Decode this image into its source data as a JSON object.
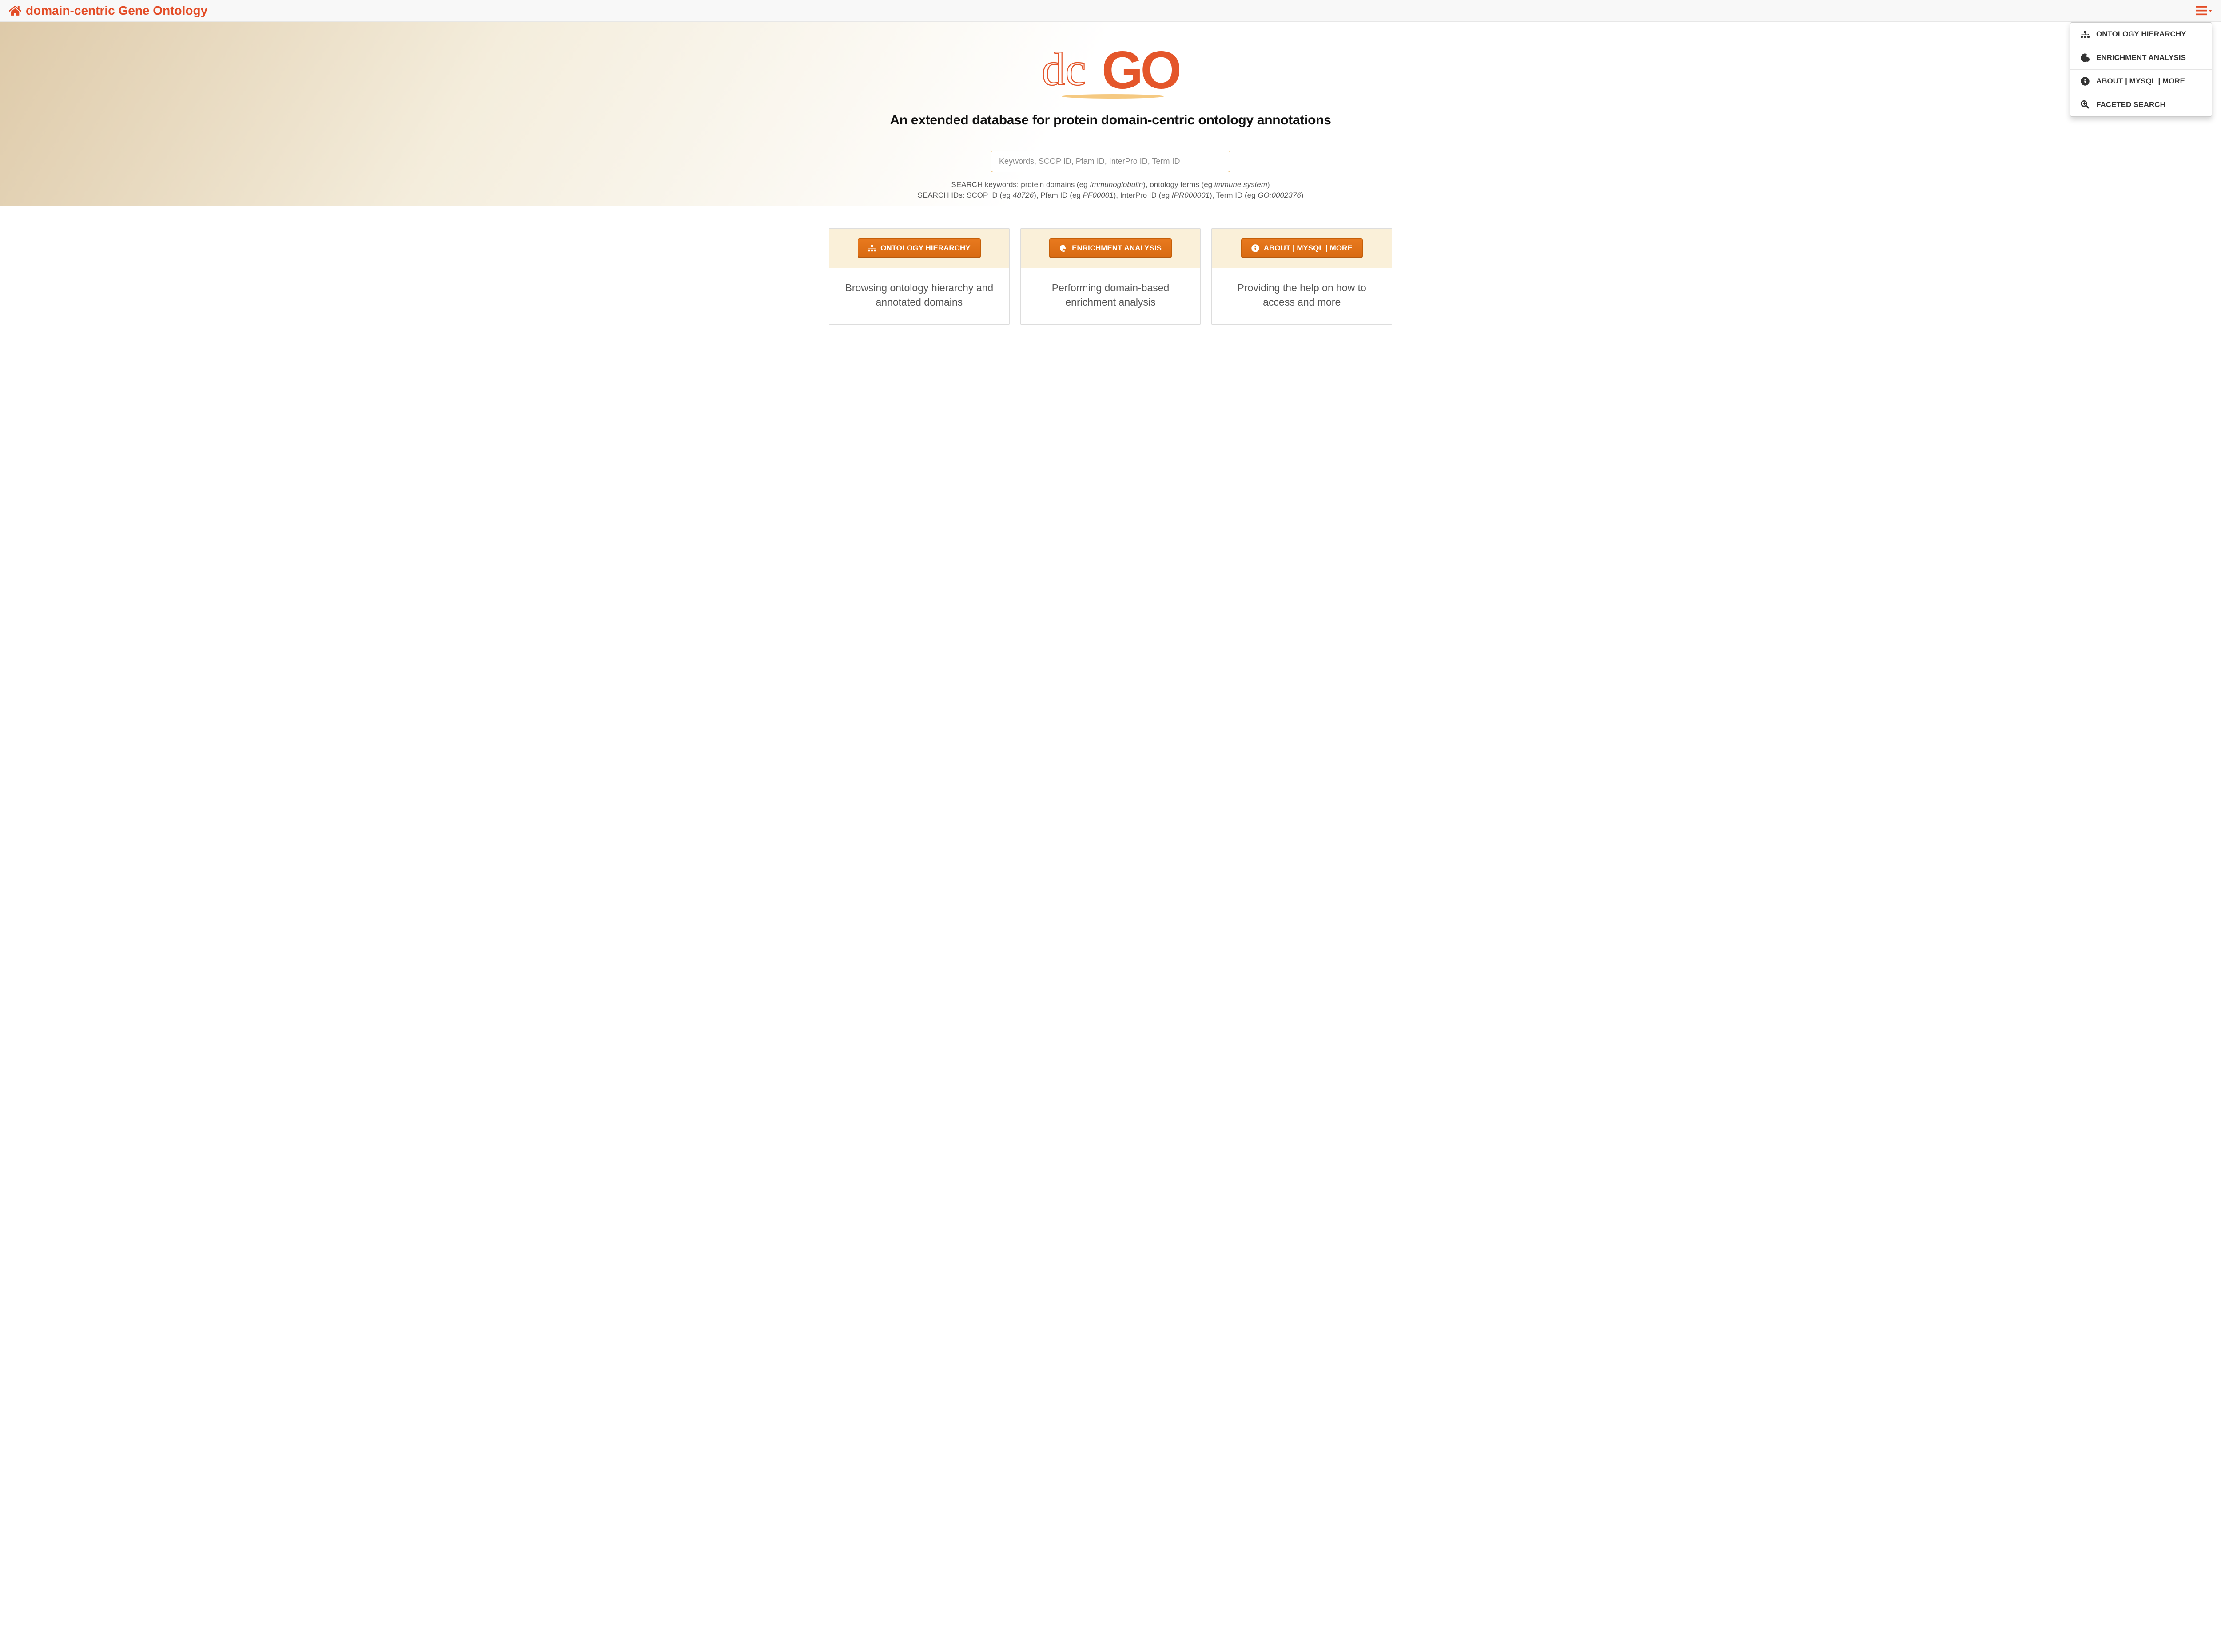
{
  "nav": {
    "title": "domain-centric Gene Ontology"
  },
  "dropdown": {
    "items": [
      {
        "label": "ONTOLOGY HIERARCHY",
        "icon": "sitemap"
      },
      {
        "label": "ENRICHMENT ANALYSIS",
        "icon": "enrich"
      },
      {
        "label": "ABOUT | MYSQL | MORE",
        "icon": "info"
      },
      {
        "label": "FACETED SEARCH",
        "icon": "zoom"
      }
    ]
  },
  "hero": {
    "logo_dc": "dc",
    "logo_go": "GO",
    "tagline": "An extended database for protein domain-centric ontology annotations",
    "search_placeholder": "Keywords, SCOP ID, Pfam ID, InterPro ID, Term ID",
    "help1_prefix": "SEARCH keywords: protein domains (eg ",
    "help1_em1": "Immunoglobulin",
    "help1_mid": "), ontology terms (eg ",
    "help1_em2": "immune system",
    "help1_suffix": ")",
    "help2_prefix": "SEARCH IDs: SCOP ID (eg ",
    "help2_em1": "48726",
    "help2_mid1": "), Pfam ID (eg ",
    "help2_em2": "PF00001",
    "help2_mid2": "), InterPro ID (eg ",
    "help2_em3": "IPR000001",
    "help2_mid3": "), Term ID (eg ",
    "help2_em4": "GO:0002376",
    "help2_suffix": ")"
  },
  "cards": [
    {
      "button": "ONTOLOGY HIERARCHY",
      "icon": "sitemap",
      "body": "Browsing ontology hierarchy and annotated domains"
    },
    {
      "button": "ENRICHMENT ANALYSIS",
      "icon": "enrich",
      "body": "Performing domain-based enrichment analysis"
    },
    {
      "button": "ABOUT | MYSQL | MORE",
      "icon": "info",
      "body": "Providing the help on how to access and more"
    }
  ]
}
